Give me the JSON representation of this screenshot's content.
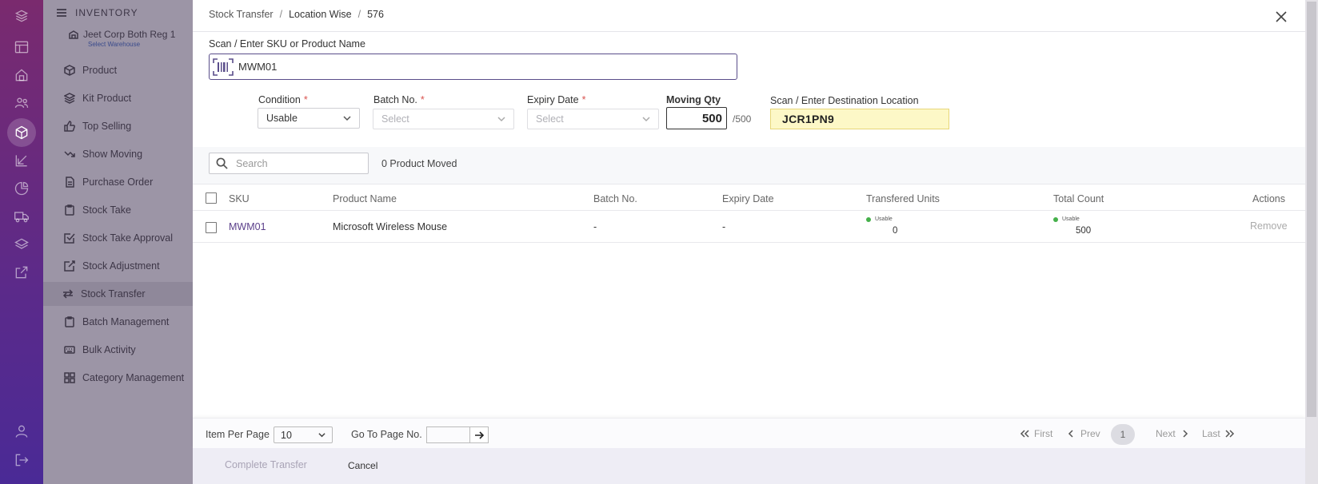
{
  "sidebar": {
    "header": "INVENTORY",
    "warehouse_name": "Jeet Corp Both Reg 1",
    "warehouse_sub": "Select Warehouse",
    "items": [
      {
        "label": "Product"
      },
      {
        "label": "Kit Product"
      },
      {
        "label": "Top Selling"
      },
      {
        "label": "Show Moving"
      },
      {
        "label": "Purchase Order"
      },
      {
        "label": "Stock Take"
      },
      {
        "label": "Stock Take Approval"
      },
      {
        "label": "Stock Adjustment"
      },
      {
        "label": "Stock Transfer"
      },
      {
        "label": "Batch Management"
      },
      {
        "label": "Bulk Activity"
      },
      {
        "label": "Category Management"
      }
    ],
    "active_item": "Stock Transfer"
  },
  "breadcrumb": {
    "root": "Stock Transfer",
    "mid": "Location Wise",
    "id": "576",
    "sep": "/"
  },
  "scan": {
    "label": "Scan / Enter SKU or Product Name",
    "value": "MWM01"
  },
  "form": {
    "condition_label": "Condition",
    "condition_value": "Usable",
    "batch_label": "Batch No.",
    "batch_placeholder": "Select",
    "expiry_label": "Expiry Date",
    "expiry_placeholder": "Select",
    "required_mark": "*",
    "moving_qty_label": "Moving Qty",
    "moving_qty_value": "500",
    "moving_qty_max": "/500",
    "destination_label": "Scan / Enter Destination Location",
    "destination_value": "JCR1PN9"
  },
  "search": {
    "placeholder": "Search",
    "moved_text": "0 Product Moved"
  },
  "table": {
    "headers": {
      "sku": "SKU",
      "product_name": "Product Name",
      "batch": "Batch No.",
      "expiry": "Expiry Date",
      "transferred": "Transfered Units",
      "total": "Total Count",
      "actions": "Actions"
    },
    "rows": [
      {
        "sku": "MWM01",
        "product_name": "Microsoft Wireless Mouse",
        "batch": "-",
        "expiry": "-",
        "transferred_status": "Usable",
        "transferred_value": "0",
        "total_status": "Usable",
        "total_value": "500",
        "action": "Remove"
      }
    ]
  },
  "pagination": {
    "per_page_label": "Item Per Page",
    "per_page_value": "10",
    "goto_label": "Go To Page No.",
    "first": "First",
    "prev": "Prev",
    "current": "1",
    "next": "Next",
    "last": "Last"
  },
  "footer": {
    "complete_label": "Complete Transfer",
    "cancel_label": "Cancel"
  },
  "colors": {
    "rail_top": "#7a2a6e",
    "rail_bottom": "#4a2a96",
    "accent": "#5b3f8a",
    "status_green": "#45b04a",
    "destination_bg": "#fdf8c7"
  }
}
